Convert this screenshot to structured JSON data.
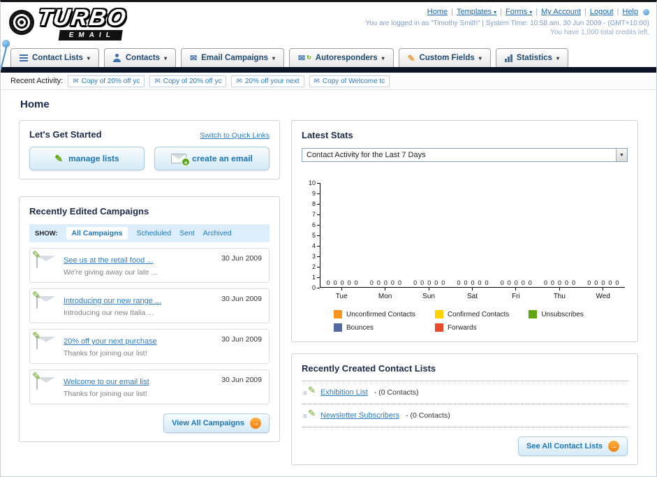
{
  "icons": {
    "caret_down": "▾",
    "select_arrow": "▼",
    "envelope": "✉",
    "pencil": "✎",
    "plus": "+",
    "refresh": "↻",
    "arrow_right": "→",
    "lines": "≡"
  },
  "header": {
    "logo_line1": "TURBO",
    "logo_line2": "EMAIL",
    "links": [
      {
        "label": "Home"
      },
      {
        "label": "Templates"
      },
      {
        "label": "Forms"
      },
      {
        "label": "My Account"
      },
      {
        "label": "Logout"
      },
      {
        "label": "Help"
      }
    ],
    "status_line": "You are logged in as \"Timothy Smith\" | System Time: 10:58 am, 30 Jun 2009 - (GMT+10:00)",
    "credits_line": "You have 1,000 total credits left."
  },
  "nav": {
    "tabs": [
      {
        "label": "Contact Lists"
      },
      {
        "label": "Contacts"
      },
      {
        "label": "Email Campaigns"
      },
      {
        "label": "Autoresponders"
      },
      {
        "label": "Custom Fields"
      },
      {
        "label": "Statistics"
      }
    ]
  },
  "activity": {
    "label": "Recent Activity:",
    "items": [
      "Copy of 20% off yc",
      "Copy of 20% off yc",
      "20% off your next",
      "Copy of Welcome tc"
    ]
  },
  "page": {
    "title": "Home"
  },
  "get_started": {
    "title": "Let's Get Started",
    "switch_link": "Switch to Quick Links",
    "manage_button": "manage lists",
    "create_button": "create an email"
  },
  "campaigns": {
    "title": "Recently Edited Campaigns",
    "show_label": "SHOW:",
    "tabs": [
      "All Campaigns",
      "Scheduled",
      "Sent",
      "Archived"
    ],
    "items": [
      {
        "title": "See us at the retail food ...",
        "subtitle": "We're giving away our late ...",
        "date": "30 Jun 2009"
      },
      {
        "title": "Introducing our new range ...",
        "subtitle": "Introducing our new Italia ...",
        "date": "30 Jun 2009"
      },
      {
        "title": "20% off your next purchase",
        "subtitle": "Thanks for joining our list!",
        "date": "30 Jun 2009"
      },
      {
        "title": "Welcome to our email list",
        "subtitle": "Thanks for joining our list!",
        "date": "30 Jun 2009"
      }
    ],
    "view_all": "View All Campaigns"
  },
  "stats": {
    "title": "Latest Stats",
    "period_selected": "Contact Activity for the Last 7 Days"
  },
  "chart_data": {
    "type": "bar",
    "title": "Contact Activity for the Last 7 Days",
    "categories": [
      "Tue",
      "Mon",
      "Sun",
      "Sat",
      "Fri",
      "Thu",
      "Wed"
    ],
    "series": [
      {
        "name": "Unconfirmed Contacts",
        "color": "#f7941d",
        "values": [
          0,
          0,
          0,
          0,
          0,
          0,
          0
        ]
      },
      {
        "name": "Confirmed Contacts",
        "color": "#ffd200",
        "values": [
          0,
          0,
          0,
          0,
          0,
          0,
          0
        ]
      },
      {
        "name": "Unsubscribes",
        "color": "#61a513",
        "values": [
          0,
          0,
          0,
          0,
          0,
          0,
          0
        ]
      },
      {
        "name": "Bounces",
        "color": "#50699e",
        "values": [
          0,
          0,
          0,
          0,
          0,
          0,
          0
        ]
      },
      {
        "name": "Forwards",
        "color": "#e64b2c",
        "values": [
          0,
          0,
          0,
          0,
          0,
          0,
          0
        ]
      }
    ],
    "ylim": [
      0,
      10
    ],
    "ylabel": "",
    "xlabel": "",
    "grid": false,
    "legend_position": "bottom",
    "value_labels_shown": true
  },
  "contact_lists": {
    "title": "Recently Created Contact Lists",
    "items": [
      {
        "name": "Exhibition List",
        "detail": "- (0 Contacts)"
      },
      {
        "name": "Newsletter Subscribers",
        "detail": "- (0 Contacts)"
      }
    ],
    "see_all": "See All Contact Lists"
  }
}
